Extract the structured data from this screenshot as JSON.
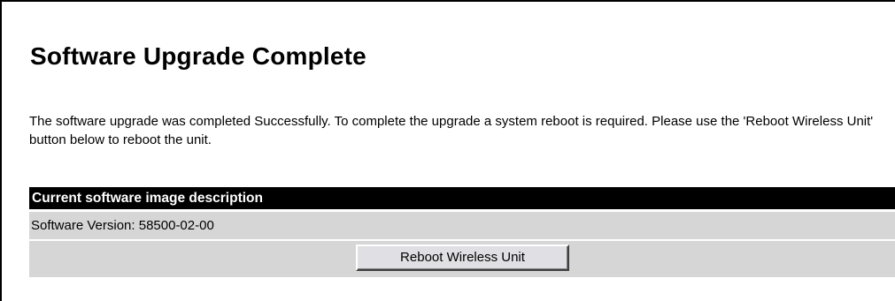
{
  "page": {
    "title": "Software Upgrade Complete",
    "message": "The software upgrade was completed Successfully. To complete the upgrade a system reboot is required. Please use the 'Reboot Wireless Unit' button below to reboot the unit."
  },
  "image_section": {
    "header": "Current software image description",
    "version_text": "Software Version: 58500-02-00"
  },
  "actions": {
    "reboot_label": "Reboot Wireless Unit"
  },
  "colors": {
    "header_background": "#000000",
    "header_text": "#ffffff",
    "row_background": "#d6d6d6",
    "button_face": "#e0dfe3"
  }
}
